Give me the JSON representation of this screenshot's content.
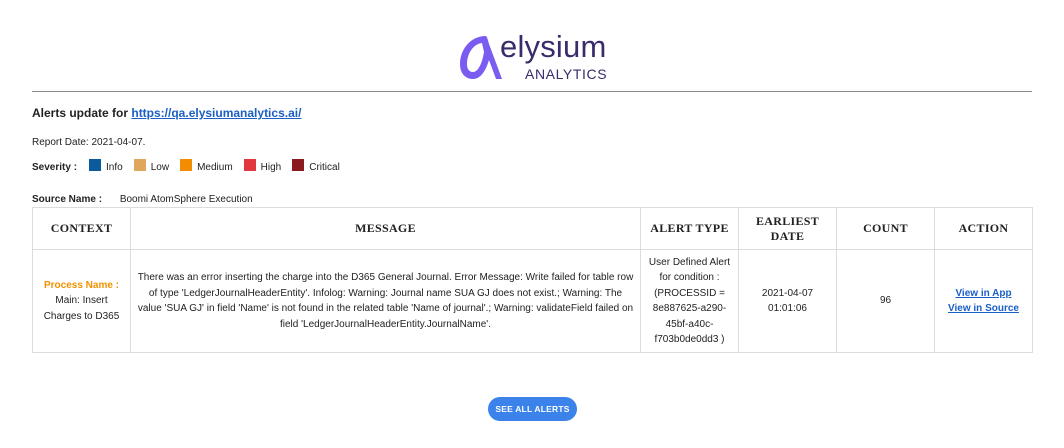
{
  "brand": {
    "logo_word": "elysium",
    "logo_sub": "ANALYTICS"
  },
  "header": {
    "alerts_prefix": "Alerts update for",
    "alerts_link": "https://qa.elysiumanalytics.ai/",
    "report_date": "Report Date: 2021-04-07."
  },
  "severity": {
    "label": "Severity :",
    "items": [
      {
        "label": "Info",
        "color": "#0b5a9e"
      },
      {
        "label": "Low",
        "color": "#e0a65c"
      },
      {
        "label": "Medium",
        "color": "#f28c00"
      },
      {
        "label": "High",
        "color": "#e0383e"
      },
      {
        "label": "Critical",
        "color": "#8b1a1f"
      }
    ]
  },
  "source": {
    "label": "Source Name :",
    "value": "Boomi AtomSphere Execution"
  },
  "table": {
    "headers": [
      "CONTEXT",
      "MESSAGE",
      "ALERT TYPE",
      "EARLIEST DATE",
      "COUNT",
      "ACTION"
    ],
    "rows": [
      {
        "context_label": "Process Name :",
        "context_value": "Main: Insert Charges to D365",
        "message": "There was an error inserting the charge into the D365 General Journal. Error Message: Write failed for table row of type 'LedgerJournalHeaderEntity'. Infolog: Warning: Journal name SUA GJ does not exist.; Warning: The value 'SUA GJ' in field 'Name' is not found in the related table 'Name of journal'.; Warning: validateField failed on field 'LedgerJournalHeaderEntity.JournalName'.",
        "alert_type": "User Defined Alert for condition : (PROCESSID = 8e887625-a290-45bf-a40c-f703b0de0dd3 )",
        "earliest_date": "2021-04-07 01:01:06",
        "count": "96",
        "actions": [
          "View in App",
          "View in Source"
        ]
      }
    ]
  },
  "footer": {
    "see_all_label": "SEE ALL ALERTS"
  }
}
